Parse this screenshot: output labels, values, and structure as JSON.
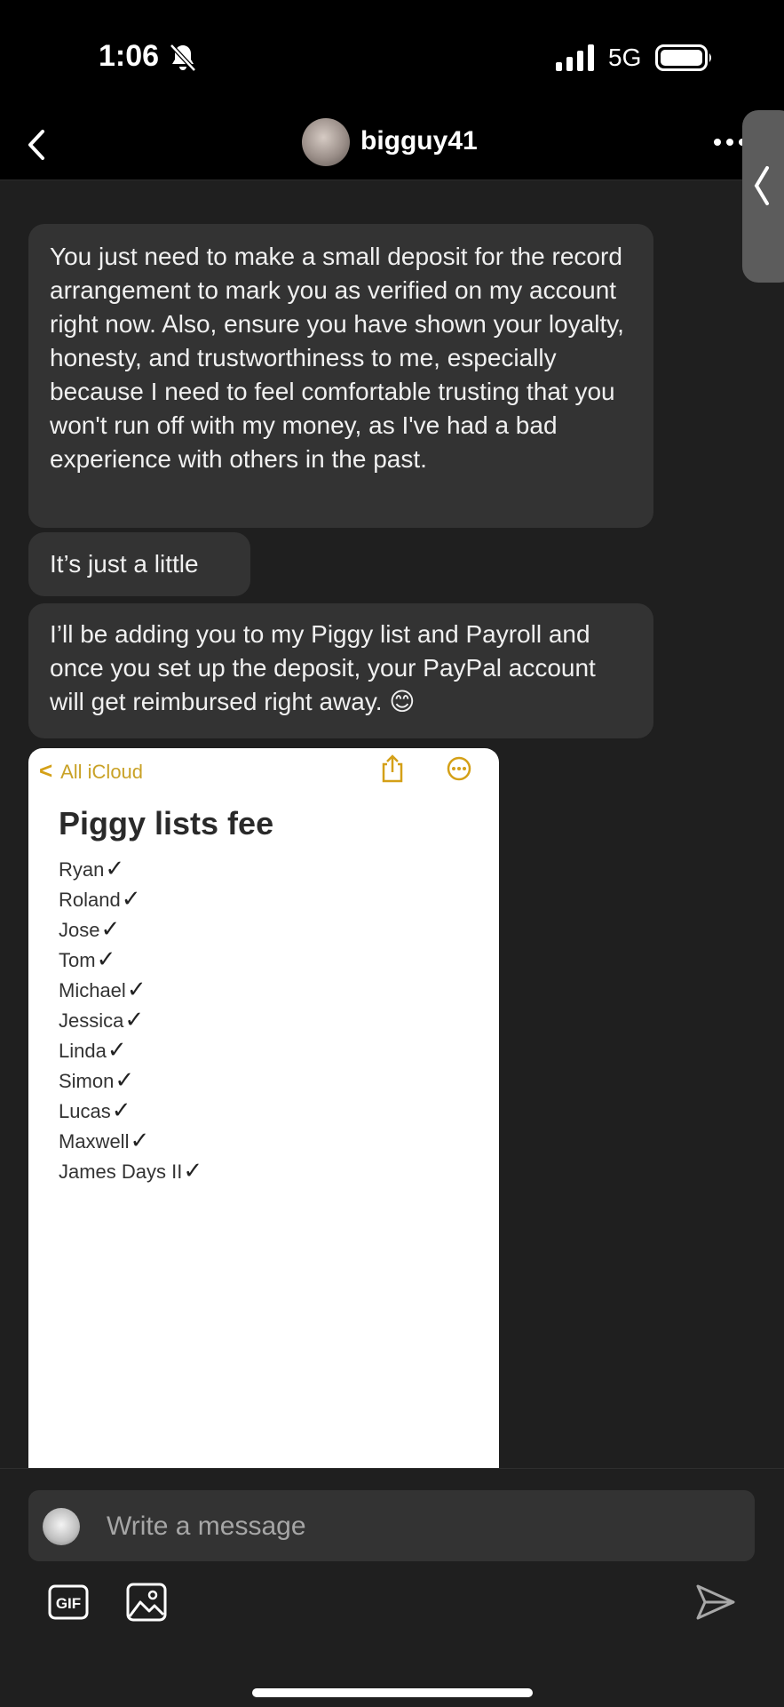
{
  "status_bar": {
    "time": "1:06",
    "network": "5G",
    "icons": [
      "bell-off-icon",
      "signal-icon",
      "battery-icon"
    ]
  },
  "header": {
    "username": "bigguy41",
    "icons": [
      "back-icon",
      "more-icon"
    ]
  },
  "messages": [
    {
      "text": "You just need to make a small deposit for the record arrangement to mark you as verified on my account right now. Also, ensure you have shown your loyalty, honesty, and trustworthiness to me, especially because I need to feel comfortable trusting that you won't run off with my money, as I've had a bad experience with others in the past."
    },
    {
      "text": "It’s just a little"
    },
    {
      "text": "I’ll be adding you to my Piggy list and Payroll and once you set up the deposit, your PayPal account will get reimbursed right away. 😊"
    }
  ],
  "note_image": {
    "back_label": "All iCloud",
    "title": "Piggy lists fee",
    "names": [
      "Ryan",
      "Roland",
      "Jose",
      "Tom",
      "Michael",
      "Jessica",
      "Linda",
      "Simon",
      "Lucas",
      "Maxwell",
      "James Days II"
    ],
    "check_mark": "✓"
  },
  "composer": {
    "placeholder": "Write a message",
    "gif_label": "GIF"
  },
  "colors": {
    "background": "#1f1f1f",
    "bubble": "#333333",
    "bar": "#000000",
    "note_accent": "#d4a017"
  }
}
